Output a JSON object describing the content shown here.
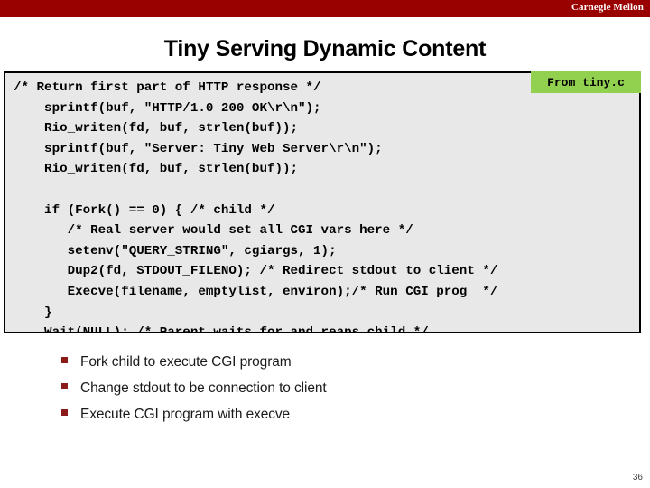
{
  "banner": {
    "brand": "Carnegie Mellon",
    "color": "#990000"
  },
  "title": "Tiny Serving Dynamic Content",
  "source_badge": {
    "label": "From tiny.c",
    "color": "#92d050"
  },
  "code": {
    "language": "c",
    "background": "#e8e8e8",
    "text": "/* Return first part of HTTP response */\n    sprintf(buf, \"HTTP/1.0 200 OK\\r\\n\");\n    Rio_writen(fd, buf, strlen(buf));\n    sprintf(buf, \"Server: Tiny Web Server\\r\\n\");\n    Rio_writen(fd, buf, strlen(buf));\n\n    if (Fork() == 0) { /* child */\n       /* Real server would set all CGI vars here */\n       setenv(\"QUERY_STRING\", cgiargs, 1);\n       Dup2(fd, STDOUT_FILENO); /* Redirect stdout to client */\n       Execve(filename, emptylist, environ);/* Run CGI prog  */\n    }\n    Wait(NULL); /* Parent waits for and reaps child */",
    "lines": [
      "/* Return first part of HTTP response */",
      "    sprintf(buf, \"HTTP/1.0 200 OK\\r\\n\");",
      "    Rio_writen(fd, buf, strlen(buf));",
      "    sprintf(buf, \"Server: Tiny Web Server\\r\\n\");",
      "    Rio_writen(fd, buf, strlen(buf));",
      "",
      "    if (Fork() == 0) { /* child */",
      "       /* Real server would set all CGI vars here */",
      "       setenv(\"QUERY_STRING\", cgiargs, 1);",
      "       Dup2(fd, STDOUT_FILENO); /* Redirect stdout to client */",
      "       Execve(filename, emptylist, environ);/* Run CGI prog  */",
      "    }",
      "    Wait(NULL); /* Parent waits for and reaps child */"
    ]
  },
  "bullets": [
    {
      "label": "Fork child to execute CGI program"
    },
    {
      "label": "Change stdout to be connection to client"
    },
    {
      "label": "Execute CGI program with execve"
    }
  ],
  "slide_number": "36"
}
